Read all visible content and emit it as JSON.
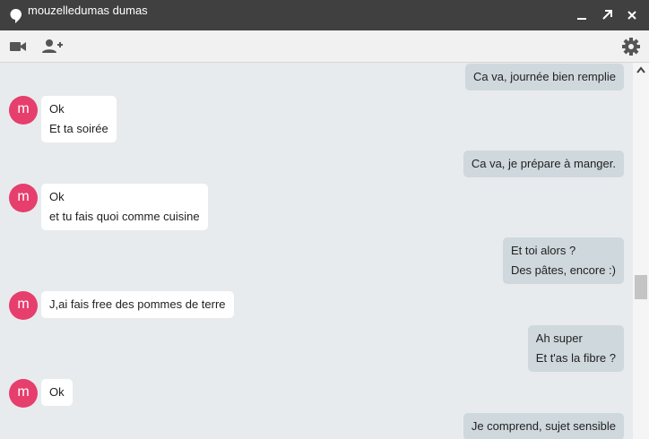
{
  "window": {
    "title": "mouzelledumas dumas",
    "controls": [
      "minimize-icon",
      "popout-icon",
      "close-icon"
    ]
  },
  "toolbar": {
    "icons": [
      "video-call-icon",
      "add-person-icon",
      "settings-gear-icon"
    ]
  },
  "conversation": {
    "avatar_letter": "m",
    "messages": [
      {
        "from": "me",
        "lines": [
          "Ca va, journée bien remplie"
        ]
      },
      {
        "from": "contact",
        "lines": [
          "Ok",
          "Et ta soirée"
        ]
      },
      {
        "from": "me",
        "lines": [
          "Ca va, je prépare à manger."
        ]
      },
      {
        "from": "contact",
        "lines": [
          "Ok",
          "et tu fais quoi comme cuisine"
        ]
      },
      {
        "from": "me",
        "lines": [
          "Et toi alors ?",
          "Des pâtes, encore :)"
        ]
      },
      {
        "from": "contact",
        "lines": [
          "J,ai fais free des pommes de terre"
        ]
      },
      {
        "from": "me",
        "lines": [
          "Ah super",
          "Et t'as la fibre ?"
        ]
      },
      {
        "from": "contact",
        "lines": [
          "Ok"
        ]
      },
      {
        "from": "me",
        "lines": [
          "Je comprend, sujet sensible"
        ]
      }
    ]
  },
  "colors": {
    "titlebar": "#404040",
    "toolbar": "#f1f1f1",
    "conversation_bg": "#e8ebee",
    "outgoing_bubble": "#cfd8dd",
    "incoming_bubble": "#ffffff",
    "avatar": "#e63e6d"
  }
}
